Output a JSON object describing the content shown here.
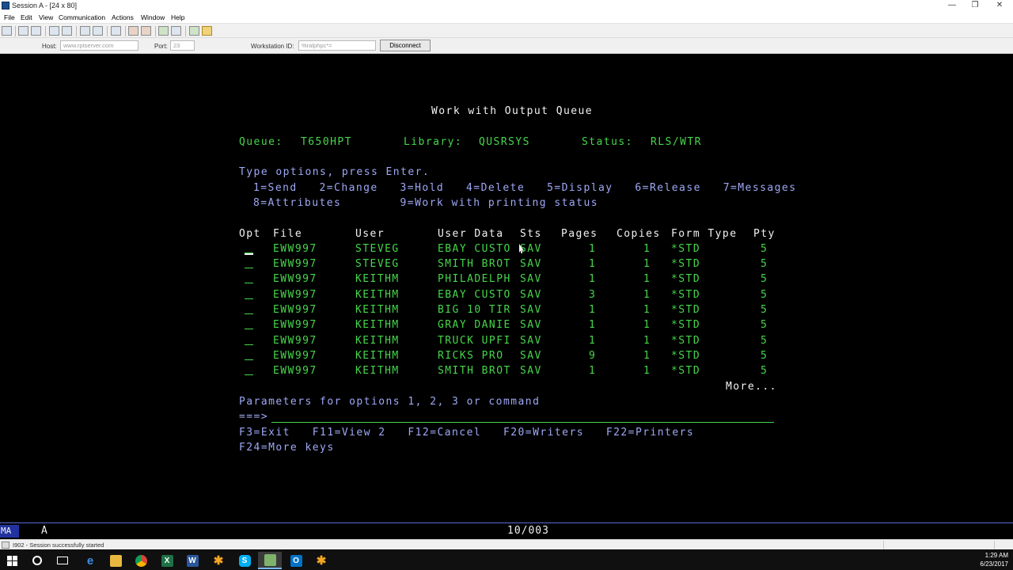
{
  "window": {
    "title": "Session A - [24 x 80]",
    "minimize": "—",
    "restore": "❐",
    "close": "✕"
  },
  "menu": [
    "File",
    "Edit",
    "View",
    "Communication",
    "Actions",
    "Window",
    "Help"
  ],
  "toolbar": {
    "icons": [
      "print-screen-icon",
      "copy-icon",
      "paste-icon",
      "send-file-icon",
      "receive-file-icon",
      "display-keypad-icon",
      "record-macro-icon",
      "stop-macro-icon",
      "play-macro-icon",
      "session-icon",
      "settings-icon",
      "help-icon"
    ]
  },
  "connection": {
    "host_label": "Host:",
    "host_value": "www.rptserver.com",
    "port_label": "Port:",
    "port_value": "23",
    "workstation_label": "Workstation ID:",
    "workstation_value": "%ralphpc*=",
    "disconnect_label": "Disconnect"
  },
  "screen": {
    "title": "Work with Output Queue",
    "queue_label": "Queue:",
    "queue_value": "T650HPT",
    "library_label": "Library:",
    "library_value": "QUSRSYS",
    "status_label": "Status:",
    "status_value": "RLS/WTR",
    "instructions": "Type options, press Enter.",
    "options_line1": "1=Send   2=Change   3=Hold   4=Delete   5=Display   6=Release   7=Messages",
    "options_line2": "8=Attributes        9=Work with printing status",
    "columns": {
      "opt": "Opt",
      "file": "File",
      "user": "User",
      "user_data": "User Data",
      "sts": "Sts",
      "pages": "Pages",
      "copies": "Copies",
      "form_type": "Form Type",
      "pty": "Pty"
    },
    "rows": [
      {
        "opt": "",
        "file": "EWW997",
        "user": "STEVEG",
        "user_data": "EBAY CUSTO",
        "sts": "SAV",
        "pages": "1",
        "copies": "1",
        "form_type": "*STD",
        "pty": "5"
      },
      {
        "opt": "",
        "file": "EWW997",
        "user": "STEVEG",
        "user_data": "SMITH BROT",
        "sts": "SAV",
        "pages": "1",
        "copies": "1",
        "form_type": "*STD",
        "pty": "5"
      },
      {
        "opt": "",
        "file": "EWW997",
        "user": "KEITHM",
        "user_data": "PHILADELPH",
        "sts": "SAV",
        "pages": "1",
        "copies": "1",
        "form_type": "*STD",
        "pty": "5"
      },
      {
        "opt": "",
        "file": "EWW997",
        "user": "KEITHM",
        "user_data": "EBAY CUSTO",
        "sts": "SAV",
        "pages": "3",
        "copies": "1",
        "form_type": "*STD",
        "pty": "5"
      },
      {
        "opt": "",
        "file": "EWW997",
        "user": "KEITHM",
        "user_data": "BIG 10 TIR",
        "sts": "SAV",
        "pages": "1",
        "copies": "1",
        "form_type": "*STD",
        "pty": "5"
      },
      {
        "opt": "",
        "file": "EWW997",
        "user": "KEITHM",
        "user_data": "GRAY DANIE",
        "sts": "SAV",
        "pages": "1",
        "copies": "1",
        "form_type": "*STD",
        "pty": "5"
      },
      {
        "opt": "",
        "file": "EWW997",
        "user": "KEITHM",
        "user_data": "TRUCK UPFI",
        "sts": "SAV",
        "pages": "1",
        "copies": "1",
        "form_type": "*STD",
        "pty": "5"
      },
      {
        "opt": "",
        "file": "EWW997",
        "user": "KEITHM",
        "user_data": "RICKS PRO",
        "sts": "SAV",
        "pages": "9",
        "copies": "1",
        "form_type": "*STD",
        "pty": "5"
      },
      {
        "opt": "",
        "file": "EWW997",
        "user": "KEITHM",
        "user_data": "SMITH BROT",
        "sts": "SAV",
        "pages": "1",
        "copies": "1",
        "form_type": "*STD",
        "pty": "5"
      }
    ],
    "more": "More...",
    "parameters_prompt": "Parameters for options 1, 2, 3 or command",
    "command_prompt": "===>",
    "command_value": "",
    "fkeys_line1": "F3=Exit   F11=View 2   F12=Cancel   F20=Writers   F22=Printers",
    "fkeys_line2": "F24=More keys"
  },
  "oia": {
    "mode": "MA",
    "indicator": "A",
    "cursor_position": "10/003"
  },
  "status_bar": {
    "message": "I902 - Session successfully started"
  },
  "taskbar": {
    "apps": [
      "windows-start-icon",
      "cortana-icon",
      "task-view-icon",
      "edge-icon",
      "file-explorer-icon",
      "chrome-icon",
      "excel-icon",
      "word-icon",
      "app-flower-icon",
      "skype-icon",
      "session-app-icon",
      "outlook-icon",
      "app-flower-icon"
    ],
    "time": "1:29 AM",
    "date": "6/23/2017"
  }
}
